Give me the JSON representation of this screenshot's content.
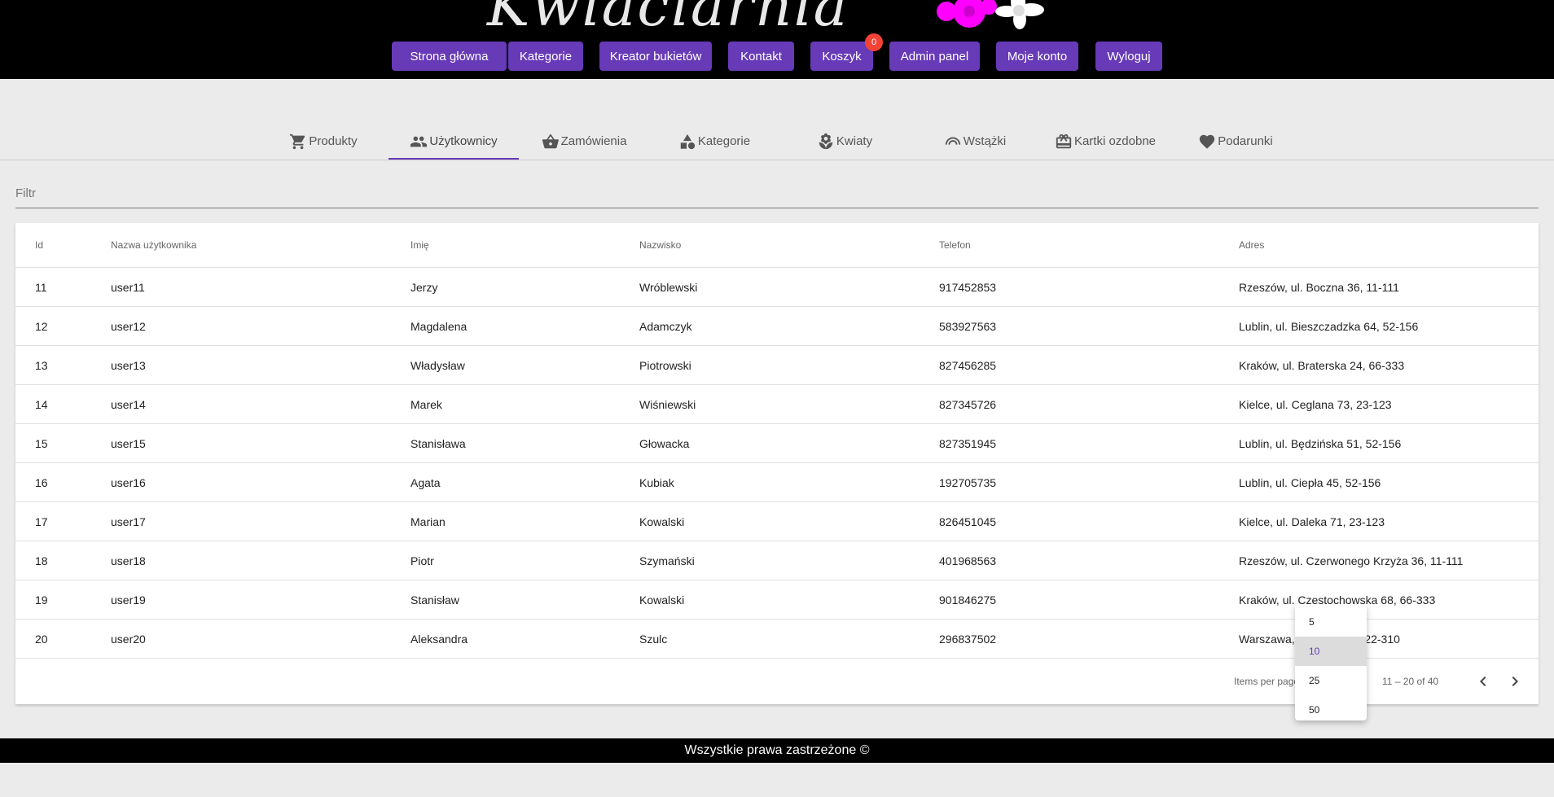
{
  "header": {
    "logo_text": "Kwiaciarnia",
    "nav": [
      {
        "label": "Strona główna"
      },
      {
        "label": "Kategorie"
      },
      {
        "label": "Kreator bukietów"
      },
      {
        "label": "Kontakt"
      },
      {
        "label": "Koszyk",
        "badge": "0"
      },
      {
        "label": "Admin panel"
      },
      {
        "label": "Moje konto"
      },
      {
        "label": "Wyloguj"
      }
    ]
  },
  "tabs": [
    {
      "label": "Produkty",
      "icon": "cart-icon"
    },
    {
      "label": "Użytkownicy",
      "icon": "people-icon",
      "active": true
    },
    {
      "label": "Zamówienia",
      "icon": "basket-icon"
    },
    {
      "label": "Kategorie",
      "icon": "category-icon"
    },
    {
      "label": "Kwiaty",
      "icon": "flower-icon"
    },
    {
      "label": "Wstążki",
      "icon": "ribbon-icon"
    },
    {
      "label": "Kartki ozdobne",
      "icon": "card-icon"
    },
    {
      "label": "Podarunki",
      "icon": "heart-icon"
    }
  ],
  "filter": {
    "placeholder": "Filtr"
  },
  "table": {
    "columns": [
      "Id",
      "Nazwa użytkownika",
      "Imię",
      "Nazwisko",
      "Telefon",
      "Adres"
    ],
    "rows": [
      [
        "11",
        "user11",
        "Jerzy",
        "Wróblewski",
        "917452853",
        "Rzeszów, ul. Boczna 36, 11-111"
      ],
      [
        "12",
        "user12",
        "Magdalena",
        "Adamczyk",
        "583927563",
        "Lublin, ul. Bieszczadzka 64, 52-156"
      ],
      [
        "13",
        "user13",
        "Władysław",
        "Piotrowski",
        "827456285",
        "Kraków, ul. Braterska 24, 66-333"
      ],
      [
        "14",
        "user14",
        "Marek",
        "Wiśniewski",
        "827345726",
        "Kielce, ul. Ceglana 73, 23-123"
      ],
      [
        "15",
        "user15",
        "Stanisława",
        "Głowacka",
        "827351945",
        "Lublin, ul. Będzińska 51, 52-156"
      ],
      [
        "16",
        "user16",
        "Agata",
        "Kubiak",
        "192705735",
        "Lublin, ul. Ciepła 45, 52-156"
      ],
      [
        "17",
        "user17",
        "Marian",
        "Kowalski",
        "826451045",
        "Kielce, ul. Daleka 71, 23-123"
      ],
      [
        "18",
        "user18",
        "Piotr",
        "Szymański",
        "401968563",
        "Rzeszów, ul. Czerwonego Krzyża 36, 11-111"
      ],
      [
        "19",
        "user19",
        "Stanisław",
        "Kowalski",
        "901846275",
        "Kraków, ul. Częstochowska 68, 66-333"
      ],
      [
        "20",
        "user20",
        "Aleksandra",
        "Szulc",
        "296837502",
        "Warszawa, ul. Cicha 18, 22-310"
      ]
    ]
  },
  "paginator": {
    "items_per_page_label": "Items per page:",
    "range_label": "11 – 20 of 40",
    "options": [
      "5",
      "10",
      "25",
      "50"
    ],
    "selected": "10"
  },
  "footer": {
    "text": "Wszystkie prawa zastrzeżone ©"
  },
  "colors": {
    "accent": "#673ab7",
    "badge": "#f44336",
    "header_bg": "#000000",
    "flower": "#ff00ff"
  }
}
